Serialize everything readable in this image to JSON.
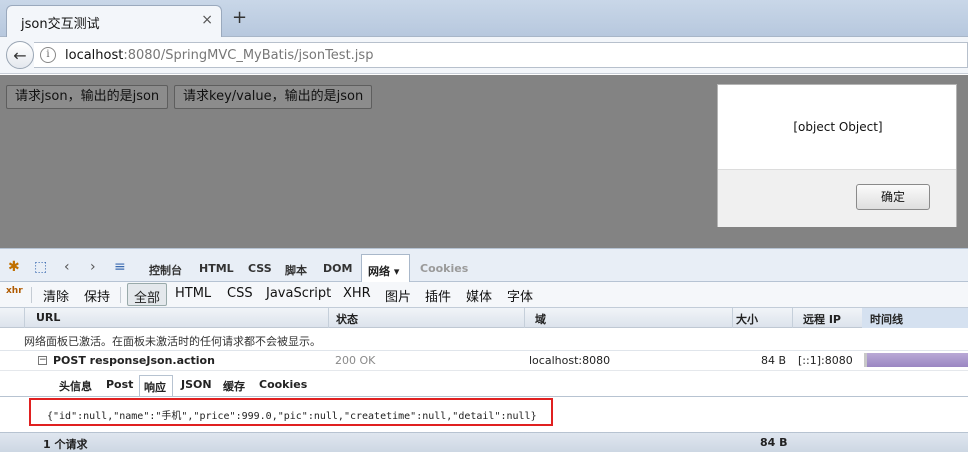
{
  "browser": {
    "tab_title": "json交互测试",
    "close_glyph": "×",
    "new_tab_glyph": "+",
    "back_glyph": "←",
    "info_glyph": "i",
    "url_host": "localhost",
    "url_rest": ":8080/SpringMVC_MyBatis/jsonTest.jsp"
  },
  "page": {
    "button_json": "请求json，输出的是json",
    "button_kv": "请求key/value，输出的是json"
  },
  "dialog": {
    "message": "[object Object]",
    "ok_label": "确定"
  },
  "firebug": {
    "tabs": [
      "控制台",
      "HTML",
      "CSS",
      "脚本",
      "DOM"
    ],
    "active_tab": "网络 ▾",
    "disabled_tab": "Cookies",
    "toolbar": {
      "xhr_icon": "xhr",
      "clear": "清除",
      "persist": "保持",
      "all": "全部",
      "filters": [
        "HTML",
        "CSS",
        "JavaScript",
        "XHR",
        "图片",
        "插件",
        "媒体",
        "字体"
      ]
    },
    "columns": {
      "url": "URL",
      "status": "状态",
      "domain": "域",
      "size": "大小",
      "remote_ip": "远程 IP",
      "timeline": "时间线"
    },
    "notice": "网络面板已激活。在面板未激活时的任何请求都不会被显示。",
    "request": {
      "toggle": "−",
      "name": "POST responseJson.action",
      "status": "200 OK",
      "domain": "localhost:8080",
      "size": "84 B",
      "remote_ip": "[::1]:8080"
    },
    "detail_tabs": {
      "headers": "头信息",
      "post": "Post",
      "response": "响应",
      "json": "JSON",
      "cache": "缓存",
      "cookies": "Cookies"
    },
    "response_body": "{\"id\":null,\"name\":\"手机\",\"price\":999.0,\"pic\":null,\"createtime\":null,\"detail\":null}",
    "footer": {
      "count": "1 个请求",
      "total_size": "84 B"
    }
  },
  "colors": {
    "highlight_border": "#e02020",
    "timeline_bar": "#9a86c2",
    "overlay": "#838383"
  }
}
